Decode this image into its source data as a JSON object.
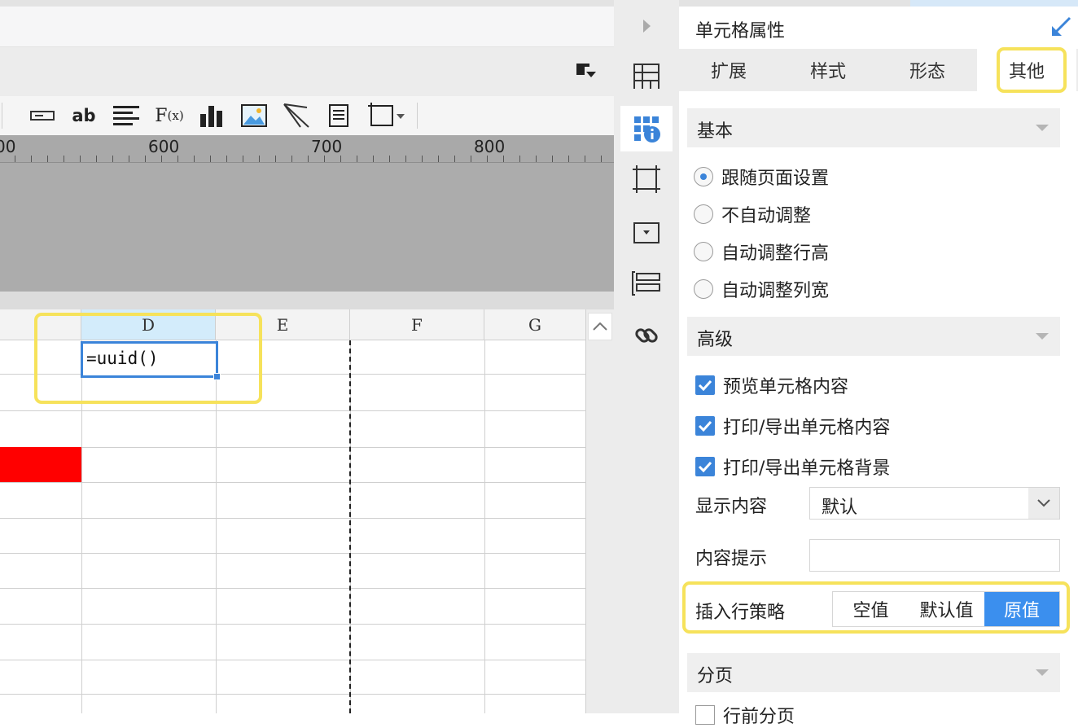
{
  "ruler": {
    "labels": [
      "00",
      "600",
      "700",
      "800"
    ]
  },
  "grid": {
    "columns": [
      "D",
      "E",
      "F",
      "G"
    ],
    "active_cell_formula": "=uuid()"
  },
  "panel": {
    "title": "单元格属性",
    "tabs": [
      "扩展",
      "样式",
      "形态",
      "其他"
    ],
    "active_tab": "其他",
    "sections": {
      "basic": "基本",
      "advanced": "高级",
      "paging": "分页"
    },
    "basic_options": [
      "跟随页面设置",
      "不自动调整",
      "自动调整行高",
      "自动调整列宽"
    ],
    "basic_selected": "跟随页面设置",
    "advanced_checks": [
      "预览单元格内容",
      "打印/导出单元格内容",
      "打印/导出单元格背景"
    ],
    "display_content_label": "显示内容",
    "display_content_value": "默认",
    "content_tip_label": "内容提示",
    "content_tip_value": "",
    "insert_row_label": "插入行策略",
    "insert_row_options": [
      "空值",
      "默认值",
      "原值"
    ],
    "insert_row_selected": "原值",
    "paging_first_check": "行前分页"
  },
  "colors": {
    "accent": "#3b84d9",
    "highlight": "#f6e25b",
    "red_cell": "#ff0000",
    "selected_header": "#d3ecfb"
  }
}
